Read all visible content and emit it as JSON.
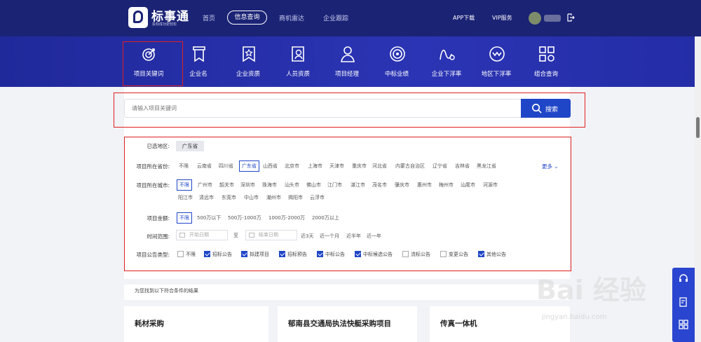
{
  "header": {
    "brand": "标事通",
    "brand_sub": "投标成功更轻松",
    "nav": [
      "首页",
      "信息查询",
      "商机雷达",
      "企业跟踪"
    ],
    "nav_active": "信息查询",
    "app_download": "APP下载",
    "vip_service": "VIP服务"
  },
  "categories": [
    {
      "label": "项目关键词",
      "icon": "target-icon",
      "active": true
    },
    {
      "label": "企业名",
      "icon": "bookmark-icon"
    },
    {
      "label": "企业资质",
      "icon": "star-bookmark-icon"
    },
    {
      "label": "人员资质",
      "icon": "person-card-icon"
    },
    {
      "label": "项目经理",
      "icon": "person-icon"
    },
    {
      "label": "中标业绩",
      "icon": "target-rings-icon"
    },
    {
      "label": "企业下浮率",
      "icon": "wave-arrow-icon"
    },
    {
      "label": "地区下浮率",
      "icon": "wave-circle-icon"
    },
    {
      "label": "组合查询",
      "icon": "grid-icon"
    }
  ],
  "search": {
    "placeholder": "请输入项目关键词",
    "button_label": "搜索"
  },
  "filters": {
    "selected_label": "已选地区:",
    "selected_chip": "广东省",
    "province_label": "项目所在省份:",
    "provinces": [
      "不限",
      "云南省",
      "四川省",
      "广东省",
      "山西省",
      "北京市",
      "上海市",
      "天津市",
      "重庆市",
      "河北省",
      "内蒙古自治区",
      "辽宁省",
      "吉林省",
      "黑龙江省"
    ],
    "province_selected": "广东省",
    "more_label": "更多 ⌄",
    "city_label": "项目所在城市:",
    "cities_row1": [
      "不限",
      "广州市",
      "韶关市",
      "深圳市",
      "珠海市",
      "汕头市",
      "佛山市",
      "江门市",
      "湛江市",
      "茂名市",
      "肇庆市",
      "惠州市",
      "梅州市",
      "汕尾市",
      "河源市"
    ],
    "cities_row2": [
      "阳江市",
      "清远市",
      "东莞市",
      "中山市",
      "潮州市",
      "揭阳市",
      "云浮市"
    ],
    "city_selected": "不限",
    "amount_label": "项目金额:",
    "amounts": [
      "不限",
      "500万以下",
      "500万-1000万",
      "1000万-2000万",
      "2000万以上"
    ],
    "amount_selected": "不限",
    "time_label": "时间范围:",
    "start_placeholder": "开始日期",
    "to_label": "至",
    "end_placeholder": "结束日期",
    "quick_ranges": [
      "近3天",
      "近一个月",
      "近半年",
      "近一年"
    ],
    "notice_label": "项目公告类型:",
    "notice_types": [
      {
        "label": "不限",
        "checked": false
      },
      {
        "label": "招标公告",
        "checked": true
      },
      {
        "label": "拟建项目",
        "checked": true
      },
      {
        "label": "招标预告",
        "checked": true
      },
      {
        "label": "中标公告",
        "checked": true
      },
      {
        "label": "中标候选公告",
        "checked": true
      },
      {
        "label": "流标公告",
        "checked": false
      },
      {
        "label": "变更公告",
        "checked": false
      },
      {
        "label": "其他公告",
        "checked": true
      }
    ]
  },
  "results": {
    "note": "为您找到以下符合条件的结果",
    "cards": [
      "耗材采购",
      "郁南县交通局执法快艇采购项目",
      "传真一体机"
    ]
  },
  "watermark": {
    "text": "Bai 经验",
    "url": "jingyan.baidu.com"
  }
}
